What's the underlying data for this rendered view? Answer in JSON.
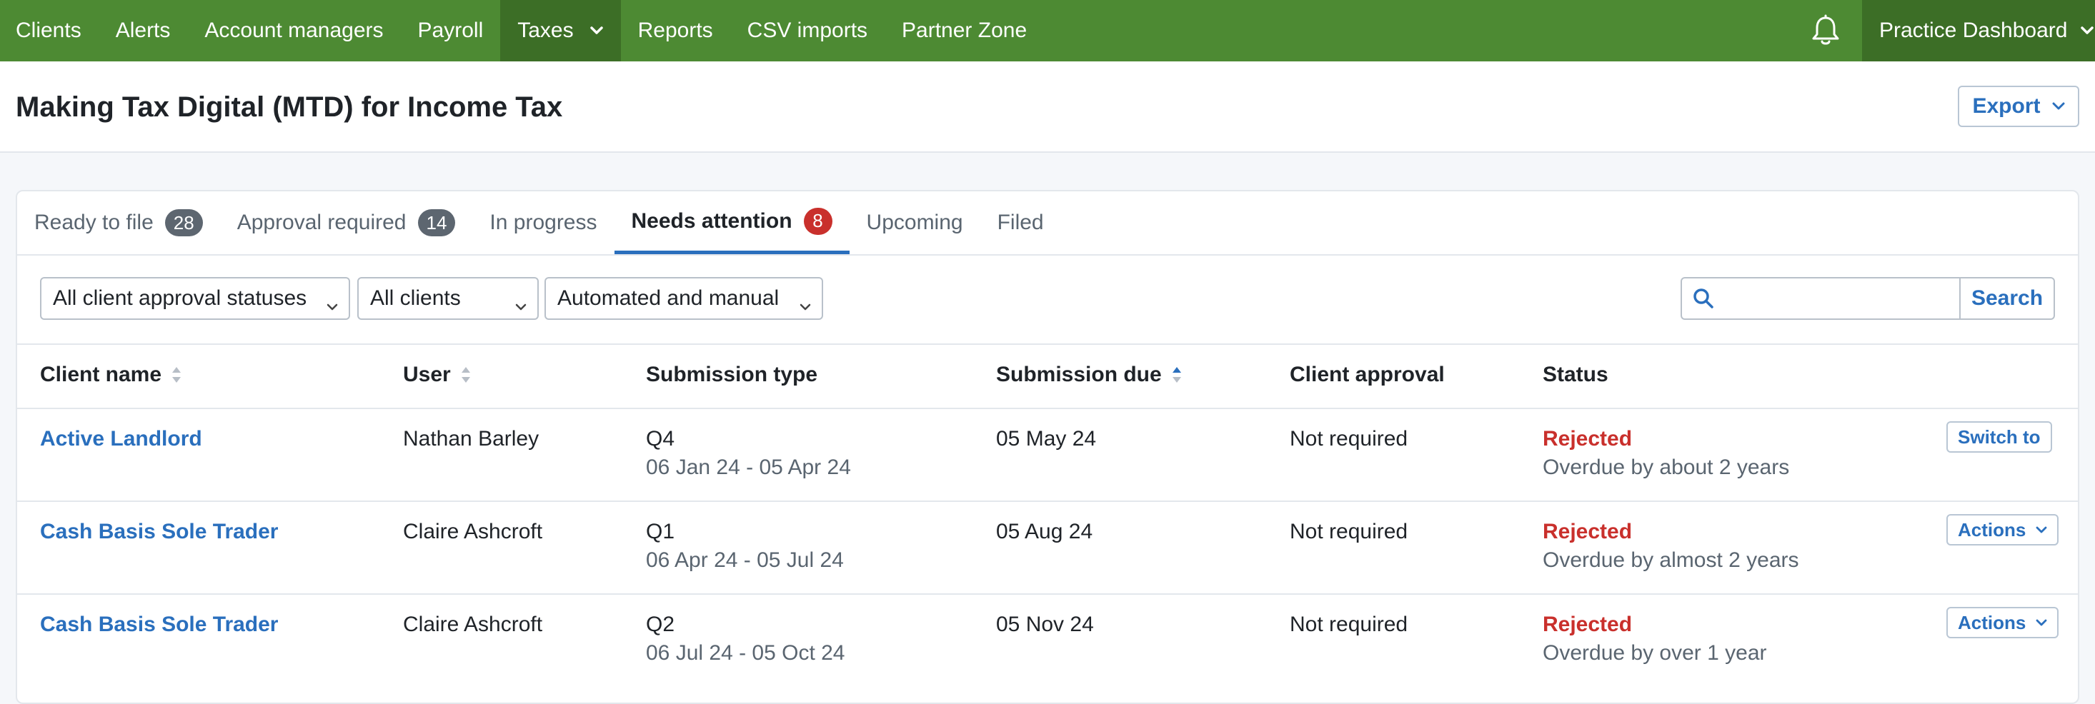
{
  "nav": {
    "items": [
      {
        "label": "Clients"
      },
      {
        "label": "Alerts"
      },
      {
        "label": "Account managers"
      },
      {
        "label": "Payroll"
      },
      {
        "label": "Taxes",
        "active": true
      },
      {
        "label": "Reports"
      },
      {
        "label": "CSV imports"
      },
      {
        "label": "Partner Zone"
      }
    ],
    "practice_label": "Practice Dashboard",
    "bell_icon": "bell-icon"
  },
  "header": {
    "title": "Making Tax Digital (MTD) for Income Tax",
    "export_label": "Export"
  },
  "tabs": [
    {
      "label": "Ready to file",
      "badge": "28"
    },
    {
      "label": "Approval required",
      "badge": "14"
    },
    {
      "label": "In progress",
      "badge": ""
    },
    {
      "label": "Needs attention",
      "badge": "8",
      "active": true
    },
    {
      "label": "Upcoming",
      "badge": ""
    },
    {
      "label": "Filed",
      "badge": ""
    }
  ],
  "filters": {
    "approval_status": "All client approval statuses",
    "clients": "All clients",
    "mode": "Automated and manual",
    "search_placeholder": "",
    "search_label": "Search"
  },
  "table": {
    "columns": {
      "client_name": "Client name",
      "user": "User",
      "submission_type": "Submission type",
      "submission_due": "Submission due",
      "client_approval": "Client approval",
      "status": "Status"
    },
    "rows": [
      {
        "client": "Active Landlord",
        "user": "Nathan Barley",
        "type": "Q4",
        "period": "06 Jan 24 - 05 Apr 24",
        "due": "05 May 24",
        "approval": "Not required",
        "status": "Rejected",
        "status_detail": "Overdue by about 2 years",
        "action": "Switch to"
      },
      {
        "client": "Cash Basis Sole Trader",
        "user": "Claire Ashcroft",
        "type": "Q1",
        "period": "06 Apr 24 - 05 Jul 24",
        "due": "05 Aug 24",
        "approval": "Not required",
        "status": "Rejected",
        "status_detail": "Overdue by almost 2 years",
        "action": "Actions"
      },
      {
        "client": "Cash Basis Sole Trader",
        "user": "Claire Ashcroft",
        "type": "Q2",
        "period": "06 Jul 24 - 05 Oct 24",
        "due": "05 Nov 24",
        "approval": "Not required",
        "status": "Rejected",
        "status_detail": "Overdue by over 1 year",
        "action": "Actions"
      }
    ]
  },
  "colors": {
    "nav_bg": "#4d8a33",
    "nav_active": "#3c6e26",
    "link": "#2a6fbd",
    "danger": "#c9302c"
  }
}
